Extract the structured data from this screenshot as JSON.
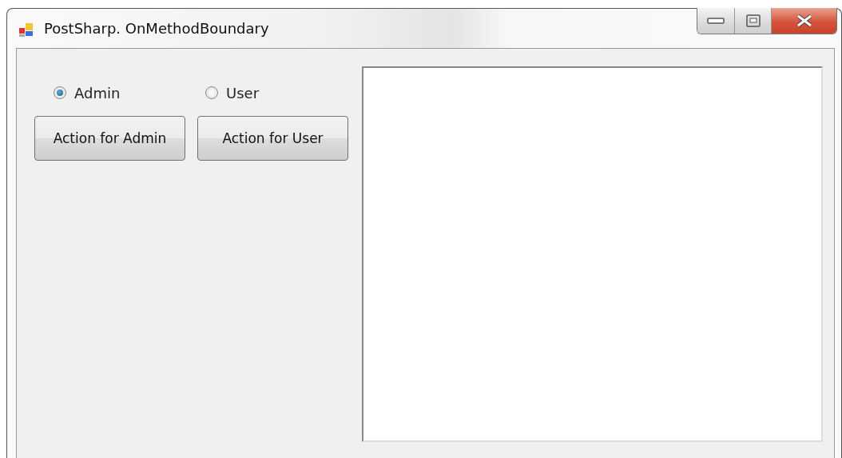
{
  "window": {
    "title": "PostSharp. OnMethodBoundary"
  },
  "roles": [
    {
      "label": "Admin",
      "selected": true
    },
    {
      "label": "User",
      "selected": false
    }
  ],
  "buttons": [
    "Action for Admin",
    "Action for User"
  ]
}
